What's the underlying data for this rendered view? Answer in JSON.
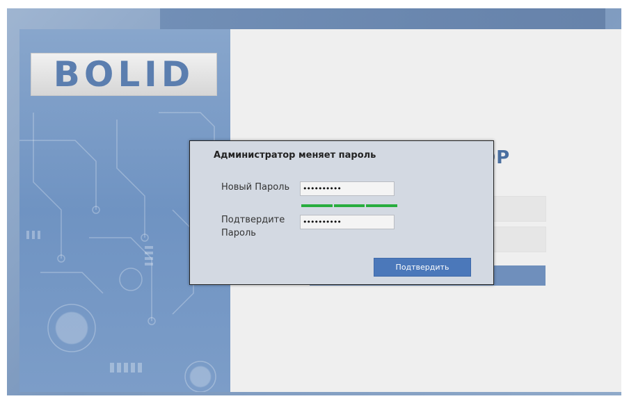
{
  "brand": {
    "logo_text": "BOLID",
    "accent": "#4b78ba",
    "strength_color": "#27ad3e"
  },
  "background_form": {
    "title_fragment": "ОР"
  },
  "dialog": {
    "title": "Администратор меняет пароль",
    "new_password": {
      "label": "Новый Пароль",
      "value": "••••••••••"
    },
    "password_strength": {
      "segments_filled": 3,
      "segments_total": 3
    },
    "confirm_password": {
      "label_line1": "Подтвердите",
      "label_line2": "Пароль",
      "value": "••••••••••"
    },
    "confirm_button": "Подтвердить"
  }
}
